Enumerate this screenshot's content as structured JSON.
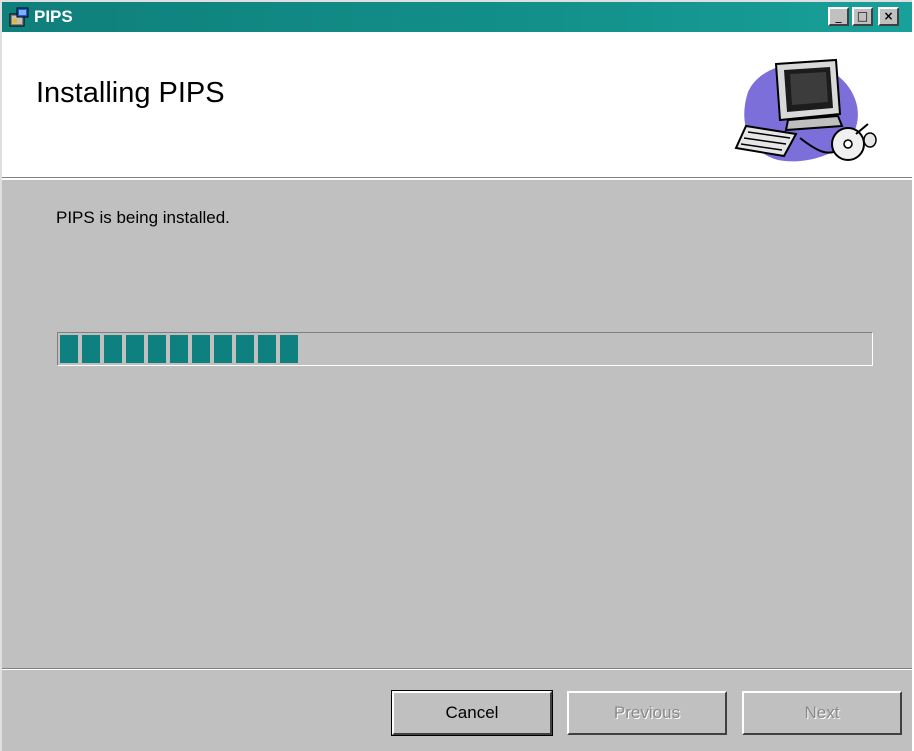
{
  "window": {
    "title": "PIPS",
    "icon": "installer-icon",
    "controls": [
      "minimize-icon",
      "maximize-icon",
      "close-icon"
    ],
    "titlebar_color": "#0f7f7b"
  },
  "header": {
    "heading": "Installing PIPS",
    "graphic": "computer-clipart"
  },
  "main": {
    "status_text": "PIPS is being installed.",
    "progress": {
      "fraction": 0.32,
      "color": "#0f8080"
    }
  },
  "buttons": {
    "cancel": "Cancel",
    "previous": "Previous",
    "next": "Next"
  }
}
